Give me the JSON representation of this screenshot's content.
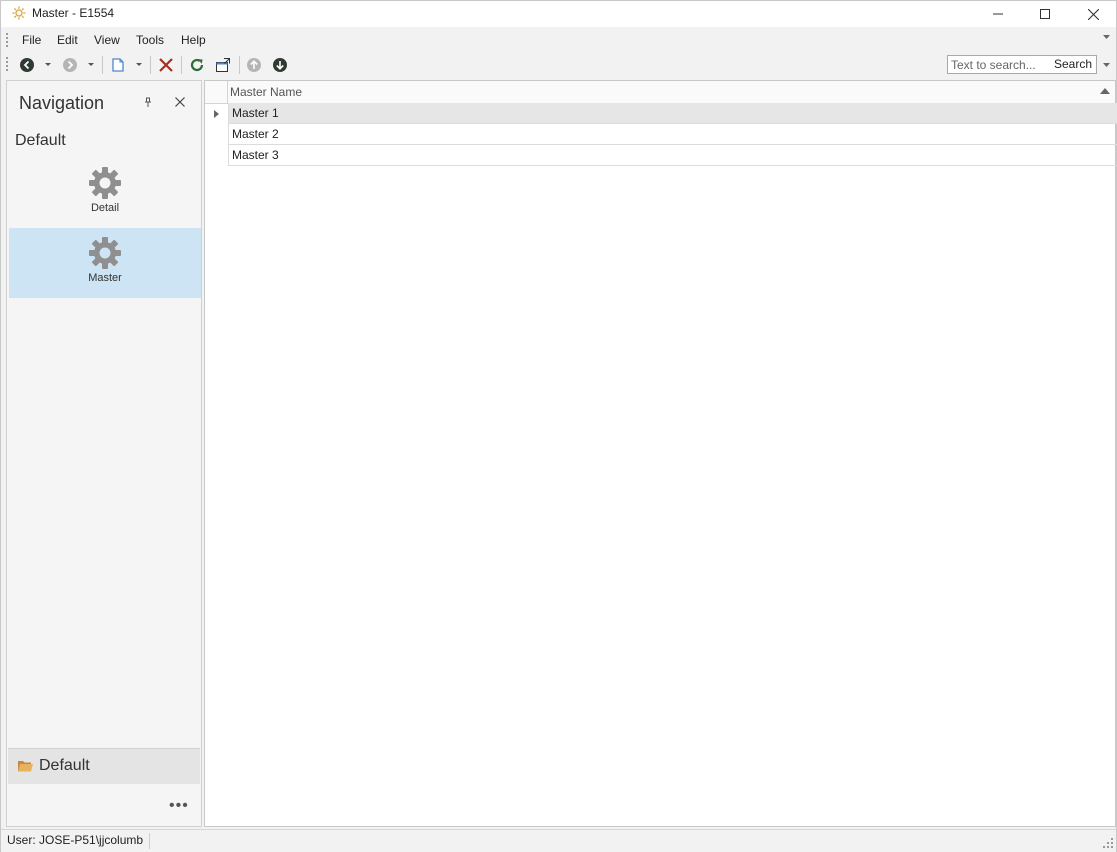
{
  "window": {
    "title": "Master - E1554"
  },
  "menu": {
    "items": [
      "File",
      "Edit",
      "View",
      "Tools",
      "Help"
    ]
  },
  "toolbar": {
    "buttons": [
      "back-icon",
      "forward-icon",
      "new-icon",
      "delete-icon",
      "refresh-icon",
      "open-window-icon",
      "previous-record-icon",
      "next-record-icon"
    ],
    "search": {
      "placeholder": "Text to search...",
      "value": "",
      "button_label": "Search"
    },
    "colors": {
      "delete": "#a5301f",
      "refresh": "#2e6b3a",
      "disabled": "#b5b5b5"
    }
  },
  "navigation": {
    "title": "Navigation",
    "group_label": "Default",
    "items": [
      {
        "label": "Detail",
        "icon": "gear-icon",
        "selected": false
      },
      {
        "label": "Master",
        "icon": "gear-icon",
        "selected": true
      }
    ],
    "footer_group": "Default",
    "more_label": "•••",
    "selected_color": "#cce4f4"
  },
  "grid": {
    "columns": [
      "Master Name"
    ],
    "rows": [
      {
        "master_name": "Master 1",
        "focused": true
      },
      {
        "master_name": "Master 2",
        "focused": false
      },
      {
        "master_name": "Master 3",
        "focused": false
      }
    ]
  },
  "status": {
    "user": "User: JOSE-P51\\jjcolumb"
  }
}
